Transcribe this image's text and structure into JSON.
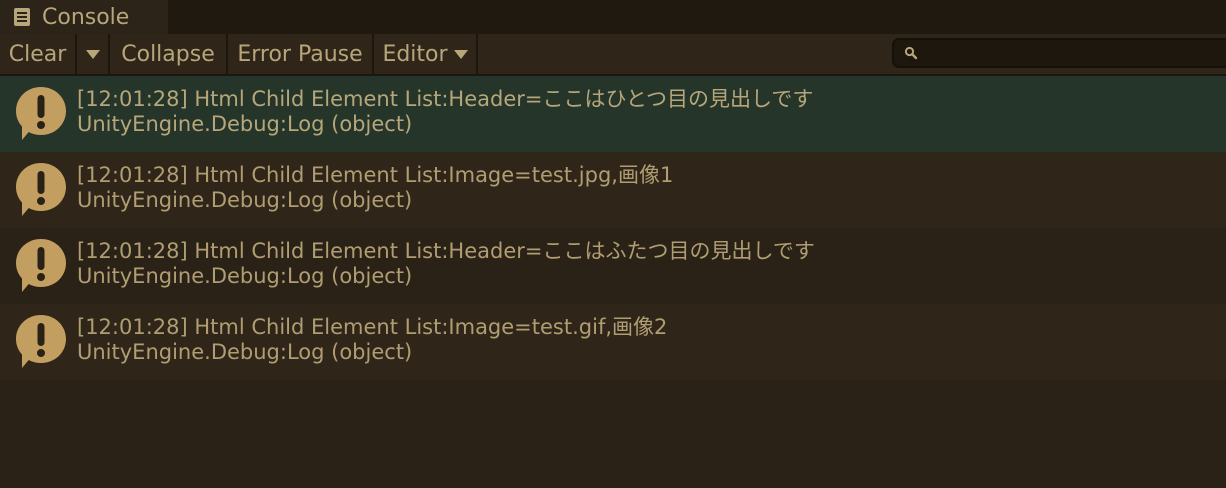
{
  "window": {
    "tab_label": "Console"
  },
  "toolbar": {
    "clear_label": "Clear",
    "collapse_label": "Collapse",
    "error_pause_label": "Error Pause",
    "editor_label": "Editor"
  },
  "search": {
    "value": ""
  },
  "colors": {
    "accent_icon": "#c39e61",
    "selected_row": "#25352a"
  },
  "log": {
    "entries": [
      {
        "line1": "[12:01:28] Html Child Element List:Header=ここはひとつ目の見出しです",
        "line2": "UnityEngine.Debug:Log (object)",
        "icon": "warning-icon"
      },
      {
        "line1": "[12:01:28] Html Child Element List:Image=test.jpg,画像1",
        "line2": "UnityEngine.Debug:Log (object)",
        "icon": "warning-icon"
      },
      {
        "line1": "[12:01:28] Html Child Element List:Header=ここはふたつ目の見出しです",
        "line2": "UnityEngine.Debug:Log (object)",
        "icon": "warning-icon"
      },
      {
        "line1": "[12:01:28] Html Child Element List:Image=test.gif,画像2",
        "line2": "UnityEngine.Debug:Log (object)",
        "icon": "warning-icon"
      }
    ]
  }
}
